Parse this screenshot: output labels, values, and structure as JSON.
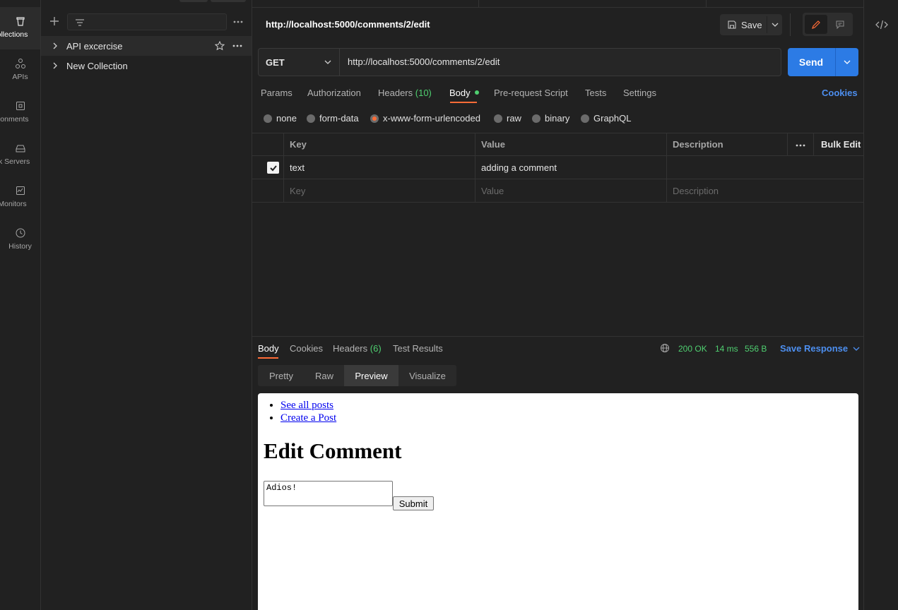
{
  "rail": {
    "items": [
      {
        "label": "ollections",
        "icon": "collections-icon"
      },
      {
        "label": "APIs",
        "icon": "apis-icon"
      },
      {
        "label": "ironments",
        "icon": "environments-icon"
      },
      {
        "label": "ck Servers",
        "icon": "mock-servers-icon"
      },
      {
        "label": "Monitors",
        "icon": "monitors-icon"
      },
      {
        "label": "History",
        "icon": "history-icon"
      }
    ]
  },
  "sidebar": {
    "collections": [
      {
        "name": "API excercise"
      },
      {
        "name": "New Collection"
      }
    ]
  },
  "request": {
    "title": "http://localhost:5000/comments/2/edit",
    "save_label": "Save",
    "method": "GET",
    "url": "http://localhost:5000/comments/2/edit",
    "send_label": "Send",
    "tabs": {
      "params": "Params",
      "authorization": "Authorization",
      "headers": "Headers",
      "headers_count": "(10)",
      "body": "Body",
      "prerequest": "Pre-request Script",
      "tests": "Tests",
      "settings": "Settings"
    },
    "cookies_label": "Cookies",
    "body_modes": [
      "none",
      "form-data",
      "x-www-form-urlencoded",
      "raw",
      "binary",
      "GraphQL"
    ],
    "table": {
      "col_key": "Key",
      "col_value": "Value",
      "col_description": "Description",
      "bulk_edit": "Bulk Edit",
      "rows": [
        {
          "key": "text",
          "value": "adding a comment",
          "description": ""
        }
      ],
      "placeholder_key": "Key",
      "placeholder_value": "Value",
      "placeholder_description": "Description"
    }
  },
  "response": {
    "tabs": {
      "body": "Body",
      "cookies": "Cookies",
      "headers": "Headers",
      "headers_count": "(6)",
      "test_results": "Test Results"
    },
    "status": "200 OK",
    "time": "14 ms",
    "size": "556 B",
    "save_response": "Save Response",
    "view_modes": [
      "Pretty",
      "Raw",
      "Preview",
      "Visualize"
    ],
    "preview": {
      "links": [
        "See all posts",
        "Create a Post"
      ],
      "heading": "Edit Comment",
      "textarea_value": "Adios!",
      "submit_label": "Submit"
    }
  },
  "colors": {
    "accent": "#ff6c37",
    "primary": "#2c7be5",
    "success": "#4fcf70",
    "link": "#4d8ff0"
  }
}
